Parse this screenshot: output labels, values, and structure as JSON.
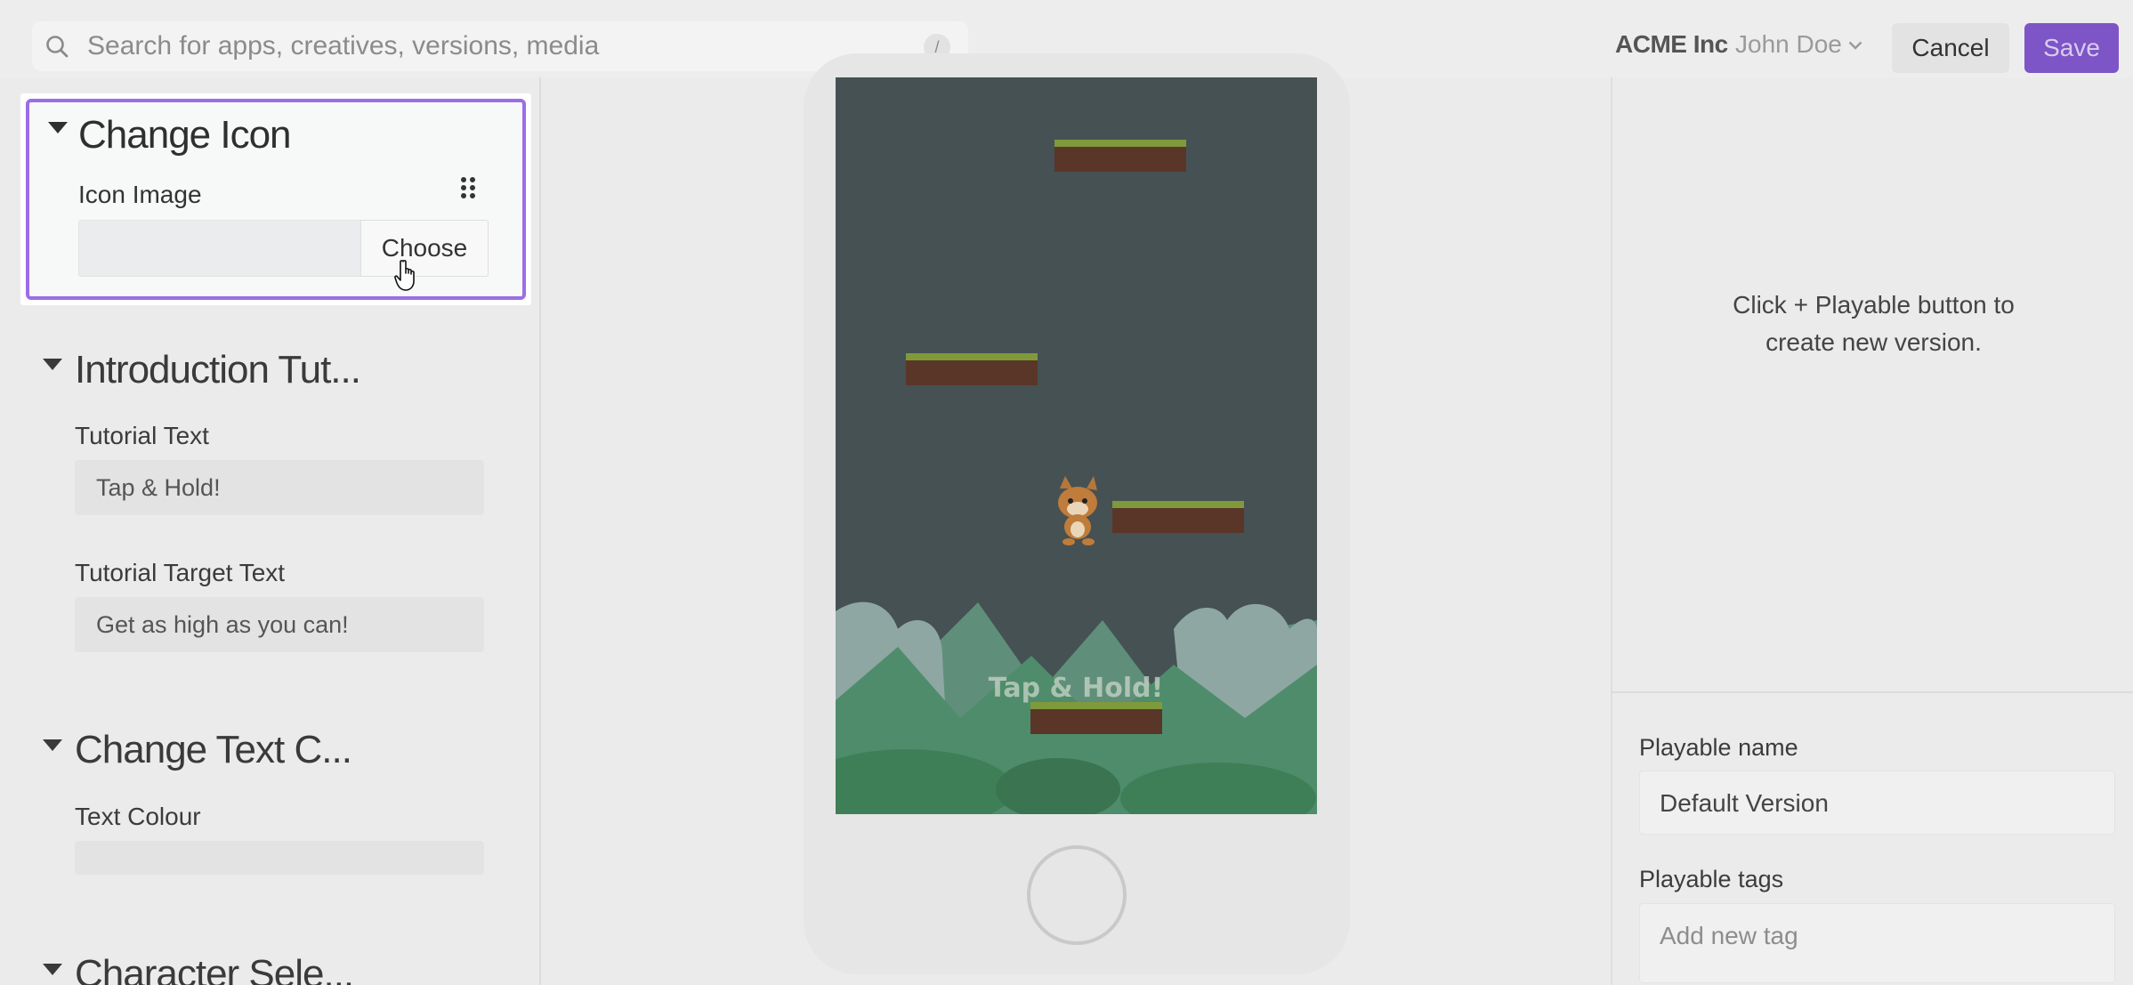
{
  "search": {
    "placeholder": "Search for apps, creatives, versions, media",
    "shortcut": "/"
  },
  "header": {
    "org": "ACME Inc",
    "user": "John Doe",
    "cancel_label": "Cancel",
    "save_label": "Save",
    "accent": "#7d55c7"
  },
  "left_panel": {
    "change_icon": {
      "title": "Change Icon",
      "icon_image_label": "Icon Image",
      "choose_label": "Choose",
      "highlight_color": "#9b6ee6"
    },
    "intro_tutorial": {
      "title": "Introduction Tut...",
      "tutorial_text_label": "Tutorial Text",
      "tutorial_text_value": "Tap & Hold!",
      "tutorial_target_label": "Tutorial Target Text",
      "tutorial_target_value": "Get as high as you can!"
    },
    "change_text_colour": {
      "title": "Change Text C...",
      "text_colour_label": "Text Colour"
    },
    "character_select": {
      "title": "Character Sele..."
    }
  },
  "preview": {
    "overlay_text": "Tap & Hold!"
  },
  "right_panel": {
    "empty_line1": "Click + Playable button to",
    "empty_line2": "create new version.",
    "playable_name_label": "Playable name",
    "playable_name_value": "Default Version",
    "playable_tags_label": "Playable tags",
    "playable_tags_placeholder": "Add new tag"
  }
}
